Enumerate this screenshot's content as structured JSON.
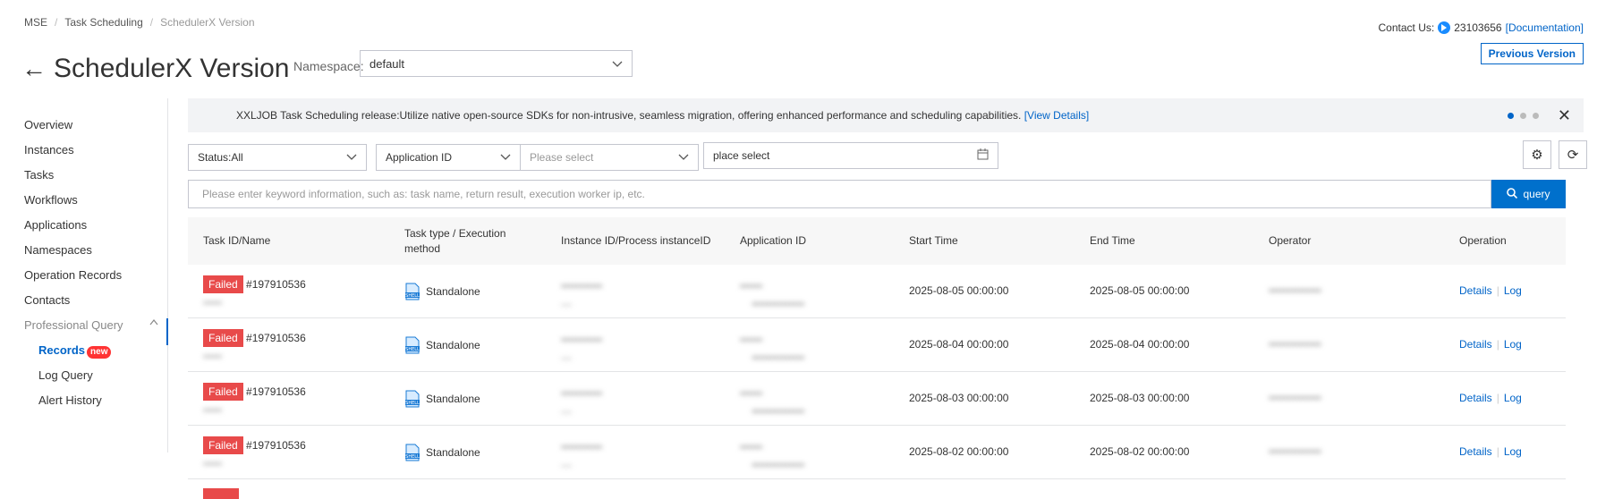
{
  "breadcrumb": [
    "MSE",
    "Task Scheduling",
    "SchedulerX Version"
  ],
  "page_title": "SchedulerX Version",
  "namespace": {
    "label": "Namespace:",
    "value": "default"
  },
  "contact": {
    "label": "Contact Us:",
    "number": "23103656",
    "doc_link": "[Documentation]"
  },
  "previous_version_label": "Previous Version",
  "sidebar": {
    "items": [
      "Overview",
      "Instances",
      "Tasks",
      "Workflows",
      "Applications",
      "Namespaces",
      "Operation Records",
      "Contacts"
    ],
    "group": "Professional Query",
    "sub_items": [
      "Records",
      "Log Query",
      "Alert History"
    ],
    "new_badge": "new"
  },
  "banner": {
    "text": "XXLJOB Task Scheduling release:Utilize native open-source SDKs for non-intrusive, seamless migration, offering enhanced performance and scheduling capabilities.",
    "link": "[View Details]"
  },
  "filters": {
    "status": "Status:All",
    "key": "Application ID",
    "value_placeholder": "Please select",
    "date_placeholder": "place select",
    "search_placeholder": "Please enter keyword information, such as: task name, return result, execution worker ip, etc.",
    "query_label": "query"
  },
  "table": {
    "headers": [
      "Task ID/Name",
      "Task type / Execution method",
      "Instance ID/Process instanceID",
      "Application ID",
      "Start Time",
      "End Time",
      "Operator",
      "Operation"
    ],
    "rows": [
      {
        "status": "Failed",
        "task_id": "#197910536",
        "method": "Standalone",
        "start": "2025-08-05 00:00:00",
        "end": "2025-08-05 00:00:00"
      },
      {
        "status": "Failed",
        "task_id": "#197910536",
        "method": "Standalone",
        "start": "2025-08-04 00:00:00",
        "end": "2025-08-04 00:00:00"
      },
      {
        "status": "Failed",
        "task_id": "#197910536",
        "method": "Standalone",
        "start": "2025-08-03 00:00:00",
        "end": "2025-08-03 00:00:00"
      },
      {
        "status": "Failed",
        "task_id": "#197910536",
        "method": "Standalone",
        "start": "2025-08-02 00:00:00",
        "end": "2025-08-02 00:00:00"
      }
    ],
    "details_label": "Details",
    "log_label": "Log"
  }
}
